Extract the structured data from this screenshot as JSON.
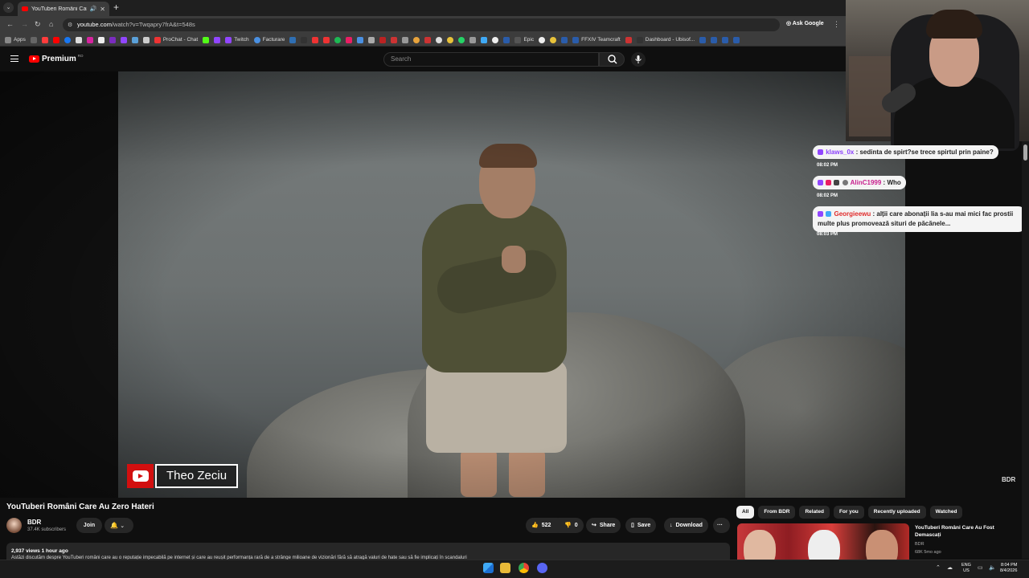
{
  "browser": {
    "tab_title": "YouTuberi Români Care Au Zero Hateri",
    "url_host": "youtube.com",
    "url_path": "/watch?v=Twqapry7frA&t=548s",
    "ask_google": "Ask Google",
    "bookmarks": {
      "apps": "Apps",
      "prochat": "ProChat - Chat",
      "twitch": "Twitch",
      "facturare": "Facturare",
      "epic": "Epic",
      "ffxiv": "FFXIV Teamcraft",
      "dashboard": "Dashboard - Ubisof..."
    }
  },
  "youtube": {
    "logo_text": "Premium",
    "logo_country": "RO",
    "search_placeholder": "Search"
  },
  "video": {
    "nameplate": "Theo Zeciu",
    "watermark": "BDR",
    "title": "YouTuberi Români Care Au Zero Hateri",
    "channel": "BDR",
    "subscribers": "37.4K subscribers",
    "join": "Join",
    "likes": "522",
    "dislikes": "0",
    "share": "Share",
    "save": "Save",
    "download": "Download",
    "more": "···",
    "views_time": "2,937 views  1 hour ago",
    "description": "Astăzi discutăm despre YouTuberi români care au o reputație impecabilă pe internet și care au reușit performanța rară de a strânge milioane de vizionări fără să atragă valuri de hate sau să fie implicați în scandaluri"
  },
  "related": {
    "chips": [
      "All",
      "From BDR",
      "Related",
      "For you",
      "Recently uploaded",
      "Watched"
    ],
    "item": {
      "title": "YouTuberi Români Care Au Fost Demascați",
      "channel": "BDR",
      "meta": "68K  5mo ago"
    }
  },
  "chat": [
    {
      "user": "klaws_0x",
      "text": "sedinta de spirt?se trece spirtul prin paine?",
      "time": "08:02 PM"
    },
    {
      "user": "AlinC1999",
      "text": "Who",
      "time": "08:02 PM"
    },
    {
      "user": "Georgieewu",
      "text_line1": "alții care abonații lia s-au mai mici fac prostii",
      "text_line2": "multe plus promovează situri de păcănele...",
      "time": "08:03 PM"
    }
  ],
  "taskbar": {
    "lang": "ENG",
    "region": "US",
    "time": "8:04 PM",
    "date": "8/4/2026"
  }
}
